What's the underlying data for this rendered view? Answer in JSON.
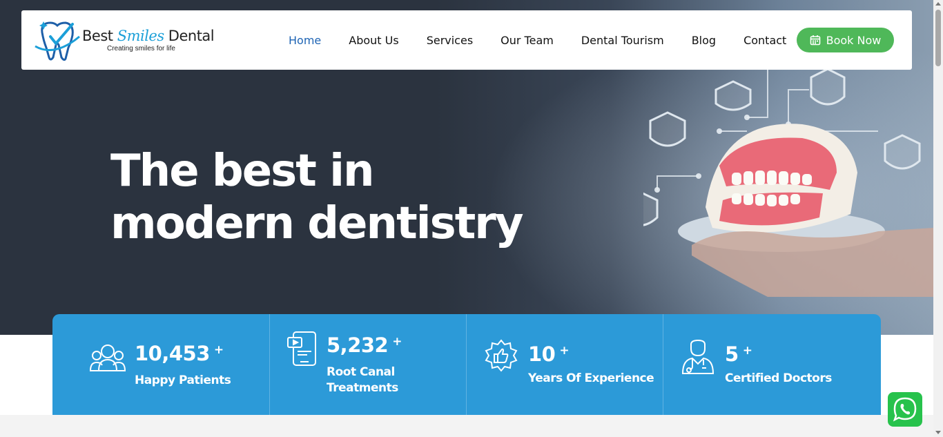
{
  "header": {
    "logo": {
      "name_part1": "Best ",
      "name_part2": "Smiles",
      "name_part3": " Dental",
      "tagline": "Creating smiles for life"
    },
    "nav": [
      {
        "label": "Home",
        "active": true
      },
      {
        "label": "About Us",
        "active": false
      },
      {
        "label": "Services",
        "active": false
      },
      {
        "label": "Our Team",
        "active": false
      },
      {
        "label": "Dental Tourism",
        "active": false
      },
      {
        "label": "Blog",
        "active": false
      },
      {
        "label": "Contact",
        "active": false
      }
    ],
    "book_button": {
      "label": "Book Now",
      "icon": "calendar-icon"
    }
  },
  "hero": {
    "title_line1": "The best in",
    "title_line2": "modern dentistry"
  },
  "stats": [
    {
      "value": "10,453",
      "suffix": "+",
      "label_line1": "Happy Patients",
      "label_line2": "",
      "icon": "patients-icon"
    },
    {
      "value": "5,232",
      "suffix": "+",
      "label_line1": "Root Canal",
      "label_line2": "Treatments",
      "icon": "tablet-video-icon"
    },
    {
      "value": "10",
      "suffix": "+",
      "label_line1": "Years Of Experience",
      "label_line2": "",
      "icon": "thumbs-up-badge-icon"
    },
    {
      "value": "5",
      "suffix": "+",
      "label_line1": "Certified Doctors",
      "label_line2": "",
      "icon": "doctor-icon"
    }
  ],
  "colors": {
    "hero_bg": "#2b333f",
    "accent_blue": "#2c9ad8",
    "nav_active": "#1e64b4",
    "book_green": "#4fb859",
    "whatsapp_green": "#27c24c"
  },
  "floating": {
    "icon": "whatsapp-icon"
  }
}
